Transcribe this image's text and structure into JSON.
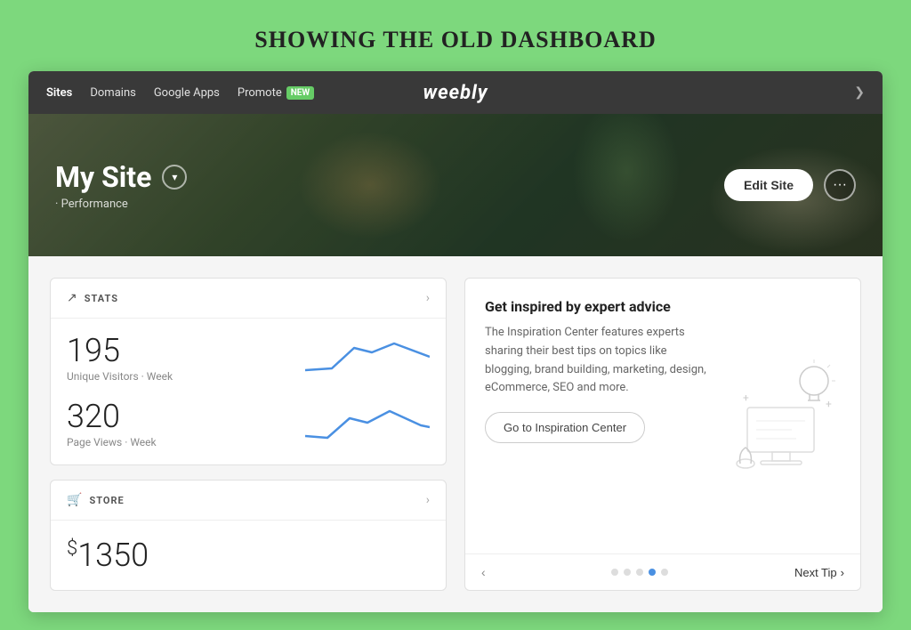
{
  "page": {
    "title": "SHOWING THE OLD DASHBOARD"
  },
  "nav": {
    "links": [
      {
        "label": "Sites",
        "active": true
      },
      {
        "label": "Domains",
        "active": false
      },
      {
        "label": "Google Apps",
        "active": false
      },
      {
        "label": "Promote",
        "active": false
      }
    ],
    "promote_badge": "NEW",
    "logo": "weebly",
    "chevron": "❯"
  },
  "hero": {
    "site_name": "My Site",
    "site_subtitle": "· Performance",
    "edit_button": "Edit Site",
    "more_icon": "···"
  },
  "stats_card": {
    "title": "STATS",
    "unique_visitors_count": "195",
    "unique_visitors_label": "Unique Visitors · Week",
    "page_views_count": "320",
    "page_views_label": "Page Views · Week"
  },
  "store_card": {
    "title": "STORE",
    "amount": "$1350"
  },
  "inspiration_card": {
    "title": "Get inspired by expert advice",
    "description": "The Inspiration Center features experts sharing their best tips on topics like blogging, brand building, marketing, design, eCommerce, SEO and more.",
    "cta_button": "Go to Inspiration Center",
    "dots_count": 5,
    "active_dot": 3,
    "nav_prev": "‹",
    "nav_next": "›",
    "next_tip_label": "Next Tip"
  }
}
